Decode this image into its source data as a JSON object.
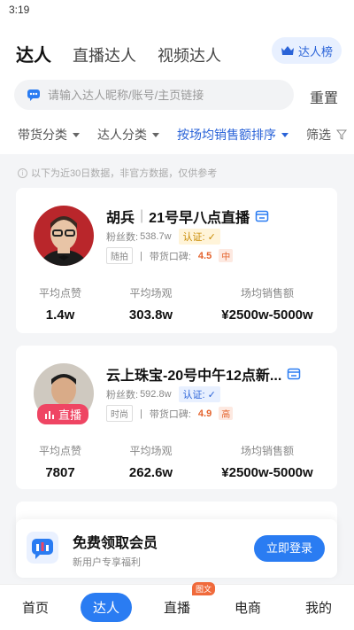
{
  "status_bar": {
    "time": "3:19"
  },
  "top_tabs": [
    {
      "label": "达人",
      "active": true
    },
    {
      "label": "直播达人",
      "active": false
    },
    {
      "label": "视频达人",
      "active": false
    }
  ],
  "rank_button": {
    "label": "达人榜",
    "icon": "crown-icon"
  },
  "search": {
    "placeholder": "请输入达人昵称/账号/主页链接",
    "value": "",
    "icon": "chat-icon"
  },
  "reset_label": "重置",
  "filters": {
    "category": "带货分类",
    "talent_category": "达人分类",
    "sort": "按场均销售额排序",
    "filter": "筛选"
  },
  "notice": "以下为近30日数据，非官方数据，仅供参考",
  "stat_labels": {
    "likes": "平均点赞",
    "views": "平均场观",
    "sales": "场均销售额"
  },
  "cards": [
    {
      "name": "胡兵",
      "subtitle": "21号早八点直播",
      "fans_label": "粉丝数:",
      "fans": "538.7w",
      "verify": "认证:",
      "tag": "随拍",
      "reputation_label": "带货口碑:",
      "score": "4.5",
      "level": "中",
      "avg_likes": "1.4w",
      "avg_views": "303.8w",
      "avg_sales": "¥2500w-5000w"
    },
    {
      "name": "云上珠宝-20号中午12点新...",
      "subtitle": "",
      "fans_label": "粉丝数:",
      "fans": "592.8w",
      "verify": "认证:",
      "tag": "时尚",
      "reputation_label": "带货口碑:",
      "score": "4.9",
      "level": "高",
      "live_badge": "直播",
      "avg_likes": "7807",
      "avg_views": "262.6w",
      "avg_sales": "¥2500w-5000w"
    }
  ],
  "promo": {
    "title": "免费领取会员",
    "subtitle": "新用户专享福利",
    "button": "立即登录"
  },
  "bottom_nav": [
    {
      "label": "首页",
      "active": false
    },
    {
      "label": "达人",
      "active": true
    },
    {
      "label": "直播",
      "active": false,
      "badge": "图文"
    },
    {
      "label": "电商",
      "active": false
    },
    {
      "label": "我的",
      "active": false
    }
  ],
  "colors": {
    "accent": "#2a7cf2",
    "live": "#ef4563",
    "score": "#e4632d"
  }
}
